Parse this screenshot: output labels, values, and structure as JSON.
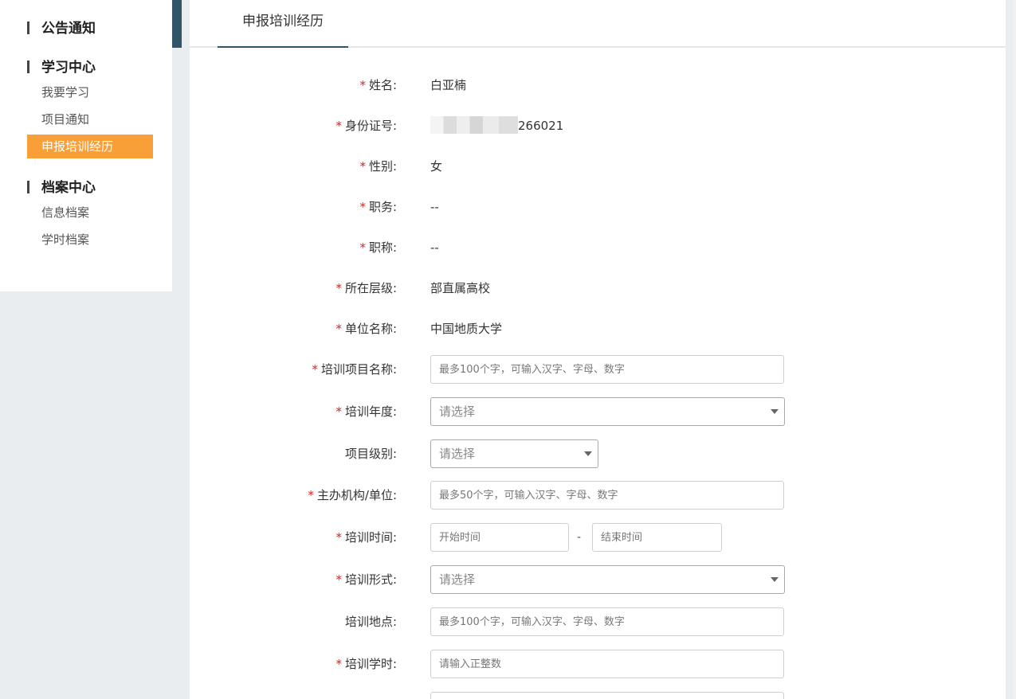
{
  "sidebar": {
    "announcements": "公告通知",
    "learning_center": "学习中心",
    "learning_items": [
      "我要学习",
      "项目通知",
      "申报培训经历"
    ],
    "active_index": 2,
    "archive_center": "档案中心",
    "archive_items": [
      "信息档案",
      "学时档案"
    ]
  },
  "tab": {
    "label": "申报培训经历"
  },
  "form": {
    "name": {
      "label": "姓名:",
      "value": "白亚楠",
      "required": true
    },
    "id_number": {
      "label": "身份证号:",
      "value_visible_suffix": "266021",
      "required": true
    },
    "gender": {
      "label": "性别:",
      "value": "女",
      "required": true
    },
    "position": {
      "label": "职务:",
      "value": "--",
      "required": true
    },
    "title": {
      "label": "职称:",
      "value": "--",
      "required": true
    },
    "level": {
      "label": "所在层级:",
      "value": "部直属高校",
      "required": true
    },
    "unit": {
      "label": "单位名称:",
      "value": "中国地质大学",
      "required": true
    },
    "project_name": {
      "label": "培训项目名称:",
      "placeholder": "最多100个字，可输入汉字、字母、数字",
      "required": true
    },
    "training_year": {
      "label": "培训年度:",
      "placeholder": "请选择",
      "required": true
    },
    "project_level": {
      "label": "项目级别:",
      "placeholder": "请选择",
      "required": false
    },
    "organizer": {
      "label": "主办机构/单位:",
      "placeholder": "最多50个字，可输入汉字、字母、数字",
      "required": true
    },
    "training_time": {
      "label": "培训时间:",
      "start_placeholder": "开始时间",
      "separator": "-",
      "end_placeholder": "结束时间",
      "required": true
    },
    "training_form": {
      "label": "培训形式:",
      "placeholder": "请选择",
      "required": true
    },
    "training_location": {
      "label": "培训地点:",
      "placeholder": "最多100个字，可输入汉字、字母、数字",
      "required": false
    },
    "training_hours": {
      "label": "培训学时:",
      "placeholder": "请输入正整数",
      "required": true
    }
  },
  "colors": {
    "accent_orange": "#f99f37",
    "accent_teal": "#2f5566",
    "required_red": "#e02020"
  }
}
